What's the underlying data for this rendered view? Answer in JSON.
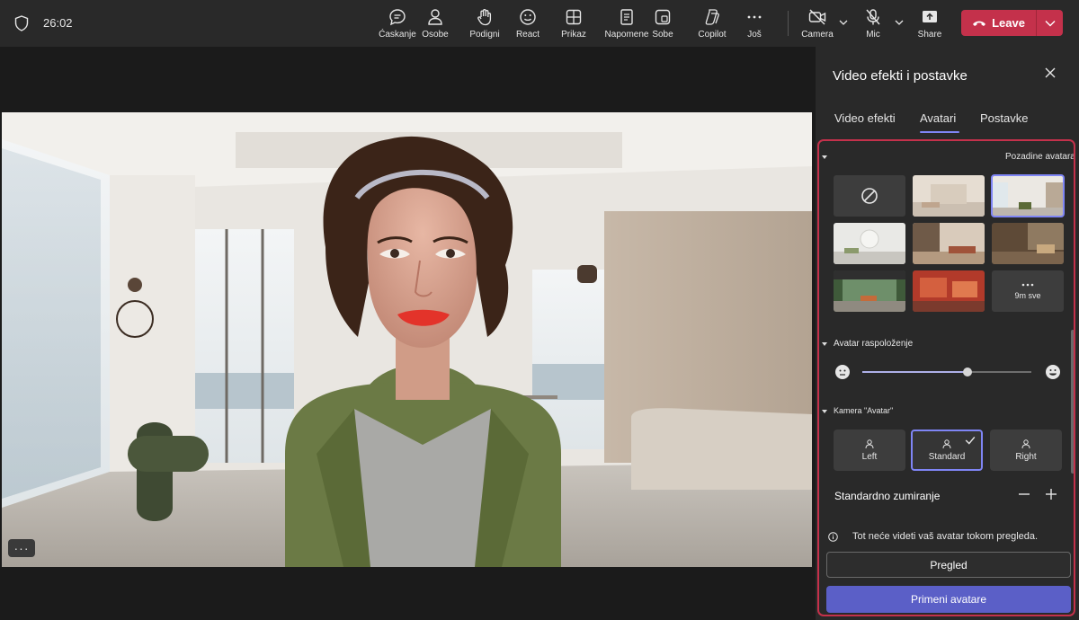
{
  "topbar": {
    "timer": "26:02",
    "buttons": {
      "chat": "Ćaskanje",
      "people": "Osobe",
      "raise": "Podigni",
      "react": "React",
      "view": "Prikaz",
      "notes": "Napomene",
      "rooms": "Sobe",
      "copilot": "Copilot",
      "more": "Još",
      "camera": "Camera",
      "mic": "Mic",
      "share": "Share"
    },
    "leave": "Leave"
  },
  "panel": {
    "title": "Video efekti i postavke",
    "tabs": [
      "Video efekti",
      "Avatari",
      "Postavke"
    ],
    "active_tab": "Avatari",
    "backgrounds_title": "Pozadine avatara",
    "see_all": "9m sve",
    "mood_title": "Avatar raspoloženje",
    "mood_level": 0.62,
    "camera_title": "Kamera \"Avatar\"",
    "camera_options": [
      "Left",
      "Standard",
      "Right"
    ],
    "camera_selected": "Standard",
    "zoom_label": "Standardno zumiranje",
    "info_text": "Tot neće videti vaš avatar tokom pregleda.",
    "preview_button": "Pregled",
    "apply_button": "Primeni avatare"
  },
  "colors": {
    "accent": "#7f85f5",
    "leave": "#c4314b",
    "apply": "#5b5fc7"
  }
}
